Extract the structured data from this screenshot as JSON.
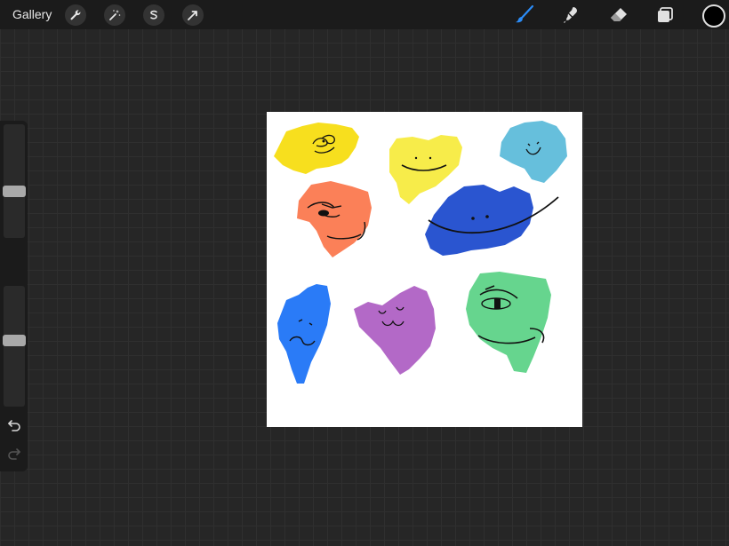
{
  "topbar": {
    "gallery_label": "Gallery",
    "left_tools": [
      "wrench-icon",
      "magic-wand-icon",
      "selection-icon",
      "arrow-icon"
    ],
    "right_tools": [
      "brush-icon",
      "smudge-icon",
      "eraser-icon",
      "layers-icon"
    ],
    "active_tool": "brush-icon",
    "accent_color": "#2b8cf7",
    "current_color": "#000000"
  },
  "sidebar": {
    "brush_size_level": 0.6,
    "opacity_level": 0.45
  },
  "canvas": {
    "background": "#ffffff",
    "blob_colors": [
      "#f7df1e",
      "#f7ec4a",
      "#66bfdc",
      "#fb8058",
      "#2a55d0",
      "#2a7bf7",
      "#b369c7",
      "#66d58e"
    ]
  }
}
